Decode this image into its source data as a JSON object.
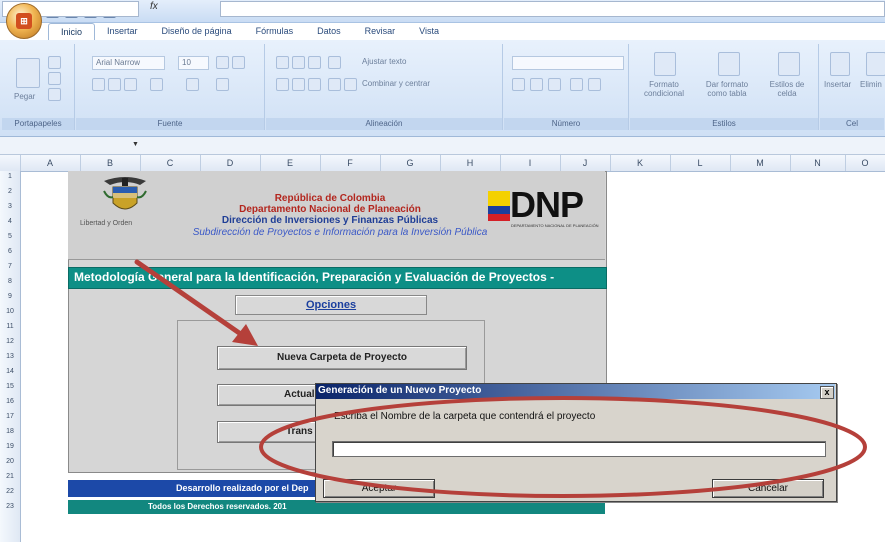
{
  "app": {
    "window_title": "",
    "office_button_icon": "office-logo-icon"
  },
  "ribbon": {
    "tabs": [
      "Inicio",
      "Insertar",
      "Diseño de página",
      "Fórmulas",
      "Datos",
      "Revisar",
      "Vista"
    ],
    "active_tab": "Inicio",
    "groups": [
      "Portapapeles",
      "Fuente",
      "Alineación",
      "Número",
      "Estilos",
      "Cel"
    ],
    "paste_label": "Pegar",
    "font_name": "Arial Narrow",
    "font_size": "10",
    "wrap_text": "Ajustar texto",
    "merge_center": "Combinar y centrar",
    "cond_format": "Formato condicional",
    "format_table": "Dar formato como tabla",
    "cell_styles": "Estilos de celda",
    "insert": "Insertar",
    "delete": "Elimin"
  },
  "formula_bar": {
    "fx": "fx",
    "value": ""
  },
  "columns": [
    "A",
    "B",
    "C",
    "D",
    "E",
    "F",
    "G",
    "H",
    "I",
    "J",
    "K",
    "L",
    "M",
    "N",
    "O"
  ],
  "rows": [
    "1",
    "2",
    "3",
    "4",
    "5",
    "6",
    "7",
    "8",
    "9",
    "10",
    "11",
    "12",
    "13",
    "14",
    "15",
    "16",
    "17",
    "18",
    "19",
    "20",
    "21",
    "22",
    "23"
  ],
  "sheet": {
    "republic": "República de Colombia",
    "dept_national": "Departamento Nacional de Planeación",
    "dept_direction": "Dirección de Inversiones y Finanzas Públicas",
    "dept_subdirection": "Subdirección de Proyectos e Información para la Inversión Pública",
    "motto": "Libertad y Orden",
    "dnp_logo": "DNP",
    "dnp_sub": "DEPARTAMENTO NACIONAL DE PLANEACIÓN",
    "title": "Metodología General para la Identificación, Preparación y Evaluación de Proyectos -",
    "options_link": "Opciones",
    "buttons": [
      "Nueva Carpeta de Proyecto",
      "Actual",
      "Trans"
    ],
    "footer1": "Desarrollo realizado por el Dep",
    "footer2": "Todos los Derechos reservados. 201"
  },
  "dialog": {
    "title": "Generación de un Nuevo Proyecto",
    "prompt": "Escriba el Nombre de la carpeta que contendrá el proyecto",
    "input_value": "",
    "accept": "Aceptar",
    "cancel": "Cancelar",
    "close": "x"
  },
  "colors": {
    "annotation_red": "#b5403a",
    "title_band": "#0d8f86",
    "footer_blue": "#1c49a8"
  }
}
